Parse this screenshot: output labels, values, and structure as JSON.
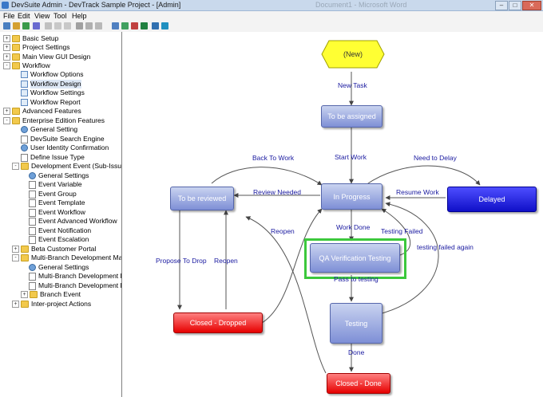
{
  "window": {
    "title": "DevSuite Admin - DevTrack Sample Project - [Admin]",
    "background_title": "Document1 - Microsoft Word"
  },
  "menu": [
    "File",
    "Edit",
    "View",
    "Tool",
    "Help"
  ],
  "tree": [
    {
      "label": "Basic Setup",
      "level": 0,
      "expander": "+",
      "icon": "folder"
    },
    {
      "label": "Project Settings",
      "level": 0,
      "expander": "+",
      "icon": "folder"
    },
    {
      "label": "Main View GUI Design",
      "level": 0,
      "expander": "+",
      "icon": "folder"
    },
    {
      "label": "Workflow",
      "level": 0,
      "expander": "-",
      "icon": "folder"
    },
    {
      "label": "Workflow Options",
      "level": 1,
      "icon": "wf"
    },
    {
      "label": "Workflow Design",
      "level": 1,
      "icon": "wf",
      "selected": true
    },
    {
      "label": "Workflow Settings",
      "level": 1,
      "icon": "wf"
    },
    {
      "label": "Workflow Report",
      "level": 1,
      "icon": "wf"
    },
    {
      "label": "Advanced Features",
      "level": 0,
      "expander": "+",
      "icon": "folder"
    },
    {
      "label": "Enterprise Edition Features",
      "level": 0,
      "expander": "-",
      "icon": "folder"
    },
    {
      "label": "General Setting",
      "level": 1,
      "icon": "person"
    },
    {
      "label": "DevSuite Search Engine",
      "level": 1,
      "icon": "page"
    },
    {
      "label": "User Identity Confirmation",
      "level": 1,
      "icon": "person"
    },
    {
      "label": "Define Issue Type",
      "level": 1,
      "icon": "page"
    },
    {
      "label": "Development Event (Sub-Issue)",
      "level": 1,
      "expander": "-",
      "icon": "folder"
    },
    {
      "label": "General Settings",
      "level": 2,
      "icon": "person"
    },
    {
      "label": "Event Variable",
      "level": 2,
      "icon": "page"
    },
    {
      "label": "Event Group",
      "level": 2,
      "icon": "page"
    },
    {
      "label": "Event Template",
      "level": 2,
      "icon": "page"
    },
    {
      "label": "Event Workflow",
      "level": 2,
      "icon": "page"
    },
    {
      "label": "Event Advanced Workflow",
      "level": 2,
      "icon": "page"
    },
    {
      "label": "Event Notification",
      "level": 2,
      "icon": "page"
    },
    {
      "label": "Event Escalation",
      "level": 2,
      "icon": "page"
    },
    {
      "label": "Beta Customer Portal",
      "level": 1,
      "expander": "+",
      "icon": "folder"
    },
    {
      "label": "Multi-Branch Development Mana",
      "level": 1,
      "expander": "-",
      "icon": "folder"
    },
    {
      "label": "General Settings",
      "level": 2,
      "icon": "person"
    },
    {
      "label": "Multi-Branch Development Lir",
      "level": 2,
      "icon": "page"
    },
    {
      "label": "Multi-Branch Development Lir",
      "level": 2,
      "icon": "page"
    },
    {
      "label": "Branch Event",
      "level": 2,
      "expander": "+",
      "icon": "folder"
    },
    {
      "label": "Inter-project Actions",
      "level": 1,
      "expander": "+",
      "icon": "folder"
    }
  ],
  "workflow": {
    "nodes": {
      "new": "(New)",
      "to_be_assigned": "To be assigned",
      "in_progress": "In Progress",
      "delayed": "Delayed",
      "to_be_reviewed": "To be reviewed",
      "qa_verification_testing": "QA Verification Testing",
      "testing": "Testing",
      "closed_dropped": "Closed - Dropped",
      "closed_done": "Closed - Done"
    },
    "transitions": {
      "new_task": "New Task",
      "start_work": "Start Work",
      "back_to_work": "Back To Work",
      "need_to_delay": "Need to Delay",
      "review_needed": "Review Needed",
      "resume_work": "Resume Work",
      "work_done": "Work Done",
      "testing_failed": "Testing Failed",
      "reopen_1": "Reopen",
      "propose_to_drop": "Propose To Drop",
      "reopen_2": "Reopen",
      "testing_failed_again": "testing failed again",
      "pass_to_testing": "Pass to testing",
      "done": "Done"
    },
    "colors": {
      "state_blue": "#8a9ae0",
      "state_red": "#ff2020",
      "state_delayed": "#2020e0",
      "state_new": "#ffff00",
      "highlight": "#3cc83c",
      "transition_label": "#1a1aa0"
    }
  }
}
